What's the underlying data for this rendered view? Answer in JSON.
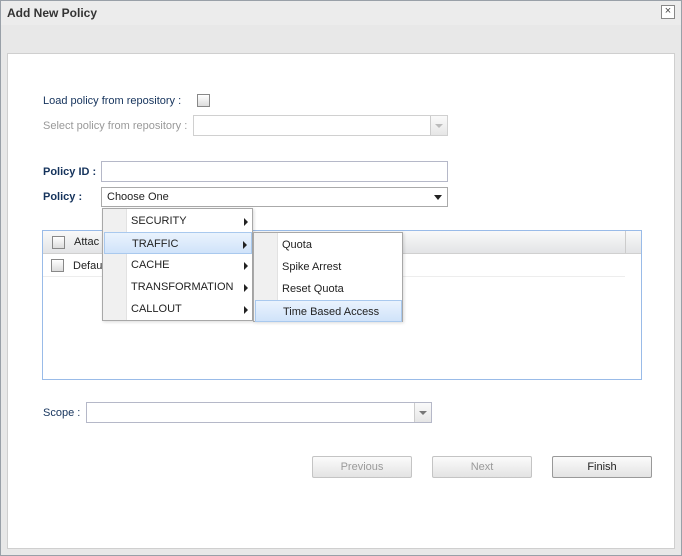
{
  "dialog": {
    "title": "Add New Policy",
    "close_label": "×"
  },
  "form": {
    "load_policy_label": "Load policy from repository :",
    "select_policy_label": "Select policy from repository :",
    "select_policy_value": "",
    "policy_id_label": "Policy ID :",
    "policy_id_value": "",
    "policy_label": "Policy :",
    "policy_value": "Choose One",
    "scope_label": "Scope :",
    "scope_value": ""
  },
  "grid": {
    "header_label": "Attac",
    "rows": [
      {
        "label": "Defau"
      }
    ]
  },
  "policy_menu": {
    "items": [
      {
        "label": "SECURITY"
      },
      {
        "label": "TRAFFIC"
      },
      {
        "label": "CACHE"
      },
      {
        "label": "TRANSFORMATION"
      },
      {
        "label": "CALLOUT"
      }
    ],
    "active_index": 1
  },
  "traffic_submenu": {
    "items": [
      {
        "label": "Quota"
      },
      {
        "label": "Spike Arrest"
      },
      {
        "label": "Reset Quota"
      },
      {
        "label": "Time Based Access"
      }
    ],
    "active_index": 3
  },
  "buttons": {
    "previous": "Previous",
    "next": "Next",
    "finish": "Finish"
  }
}
